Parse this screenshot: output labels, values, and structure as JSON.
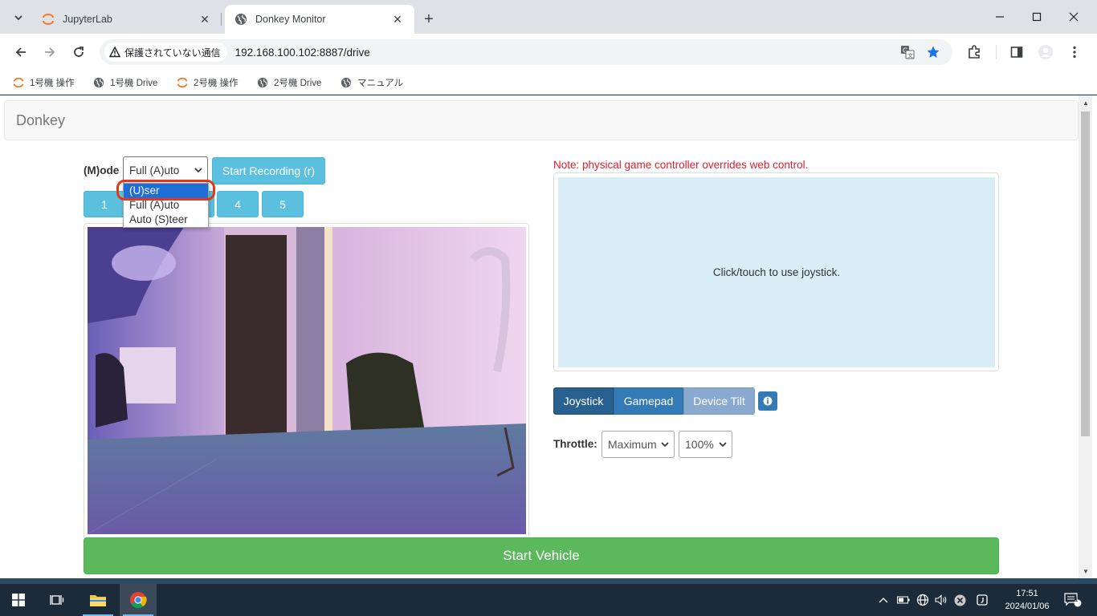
{
  "browser": {
    "tabs": [
      {
        "title": "JupyterLab",
        "icon": "jupyter-icon",
        "active": false
      },
      {
        "title": "Donkey Monitor",
        "icon": "globe-icon",
        "active": true
      }
    ],
    "security_label": "保護されていない通信",
    "url": "192.168.100.102:8887/drive",
    "bookmarks": [
      {
        "label": "1号機 操作",
        "icon": "jupyter-icon"
      },
      {
        "label": "1号機 Drive",
        "icon": "globe-icon"
      },
      {
        "label": "2号機 操作",
        "icon": "jupyter-icon"
      },
      {
        "label": "2号機 Drive",
        "icon": "globe-icon"
      },
      {
        "label": "マニュアル",
        "icon": "globe-icon"
      }
    ]
  },
  "page": {
    "brand": "Donkey",
    "mode": {
      "label": "(M)ode",
      "selected": "Full (A)uto",
      "options": [
        "(U)ser",
        "Full (A)uto",
        "Auto (S)teer"
      ],
      "highlighted_option": "(U)ser"
    },
    "record_button": "Start Recording (r)",
    "number_buttons": [
      "1",
      "4",
      "5"
    ],
    "note": "Note: physical game controller overrides web control.",
    "joystick_hint": "Click/touch to use joystick.",
    "control_modes": [
      "Joystick",
      "Gamepad",
      "Device Tilt"
    ],
    "active_control_mode": "Joystick",
    "throttle": {
      "label": "Throttle:",
      "mode": "Maximum",
      "percent": "100%"
    },
    "start_button": "Start Vehicle"
  },
  "taskbar": {
    "time": "17:51",
    "date": "2024/01/06",
    "notifications": "1"
  },
  "colors": {
    "primary": "#337ab7",
    "info": "#5bc0de",
    "success": "#5cb85c",
    "note_red": "#e0202f",
    "joystick_bg": "#d9edf7",
    "highlight_ring": "#e8361a"
  }
}
